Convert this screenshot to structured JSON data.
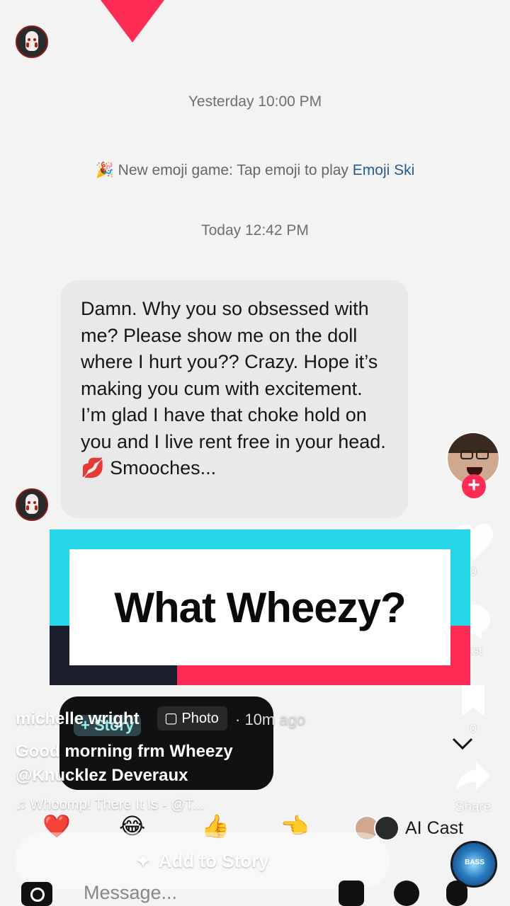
{
  "chat": {
    "timestamp_yesterday": "Yesterday 10:00 PM",
    "emoji_game_prefix": "🎉 New emoji game: Tap emoji to play ",
    "emoji_game_link": "Emoji Ski",
    "timestamp_today": "Today 12:42 PM",
    "message": "Damn. Why you so obsessed with me? Please show me on the doll where I hurt you?? Crazy. Hope it’s making you cum with excitement. I’m glad I have that choke hold on you and I live rent free in your head. 💋 Smooches..."
  },
  "banner": {
    "text": "What Wheezy?"
  },
  "story_card": {
    "label": "+ Story"
  },
  "post": {
    "username": "michelle wright",
    "type_badge": "Photo",
    "time_ago": "· 10m ago",
    "caption": "Good morning frm Wheezy",
    "mention": "@Knucklez Deveraux",
    "music": "♫ Whoomp! There It Is - @T..."
  },
  "sidebar": {
    "like_count": "0",
    "comment_label": "1st",
    "save_count": "0",
    "share_label": "Share"
  },
  "reactions": [
    "❤️",
    "😂",
    "👍",
    "👈"
  ],
  "ai_cast": {
    "label": "AI Cast"
  },
  "add_story": {
    "label": "Add to Story"
  },
  "music_disc": {
    "label": "BASS"
  },
  "message_bar": {
    "placeholder": "Message..."
  },
  "colors": {
    "tiktok_cyan": "#25d5e8",
    "tiktok_pink": "#fe2c55",
    "tiktok_black": "#1a1e2a",
    "link_blue": "#2a5a8a"
  }
}
